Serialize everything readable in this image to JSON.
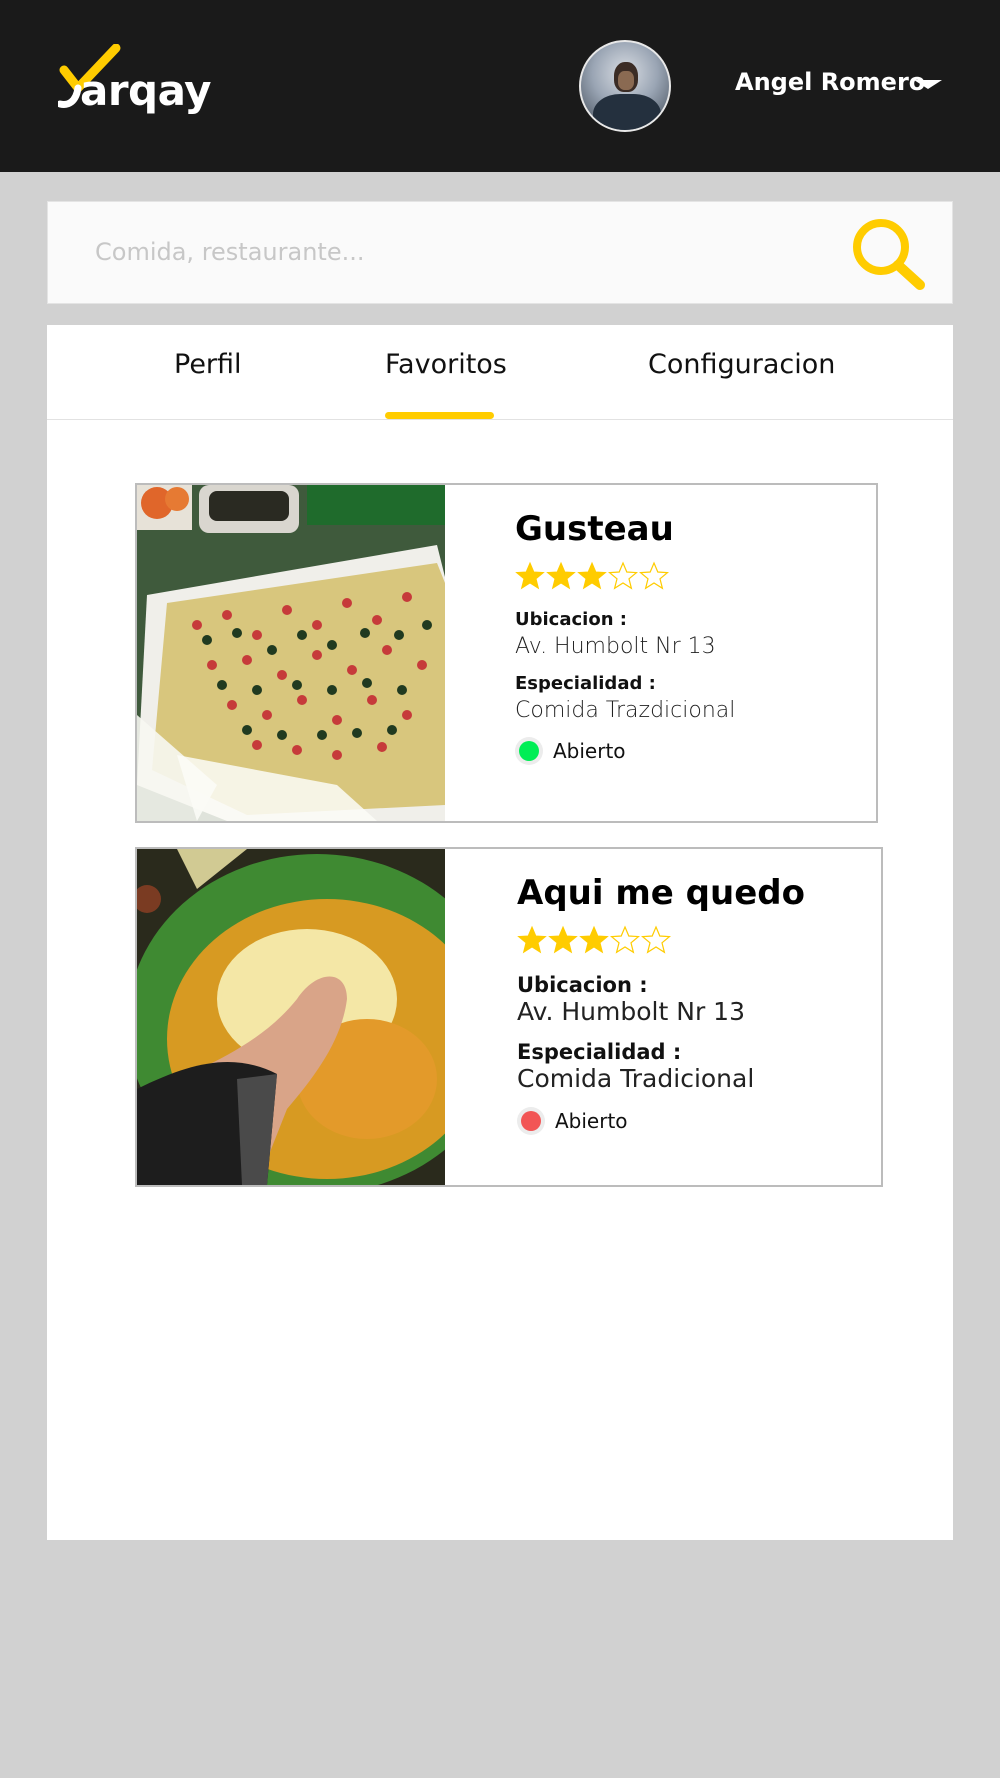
{
  "header": {
    "logo_text": "arqay",
    "user_name": "Angel Romero"
  },
  "colors": {
    "header_bg": "#1a1a1a",
    "accent": "#ffcc00",
    "page_bg": "#d1d1d1",
    "status_open_green": "#00ee55",
    "status_red": "#f25555"
  },
  "search": {
    "placeholder": "Comida, restaurante...",
    "value": "",
    "icon": "search-icon"
  },
  "tabs": [
    {
      "label": "Perfil",
      "active": false
    },
    {
      "label": "Favoritos",
      "active": true
    },
    {
      "label": "Configuracion",
      "active": false
    }
  ],
  "favorites": [
    {
      "name": "Gusteau",
      "rating": 3,
      "rating_max": 5,
      "location_label": "Ubicacion :",
      "location": "Av. Humbolt Nr 13",
      "specialty_label": "Especialidad :",
      "specialty": "Comida Trazdicional",
      "status": "Abierto",
      "status_color": "#00ee55"
    },
    {
      "name": "Aqui me quedo",
      "rating": 3,
      "rating_max": 5,
      "location_label": "Ubicacion :",
      "location": "Av. Humbolt Nr 13",
      "specialty_label": "Especialidad :",
      "specialty": "Comida Tradicional",
      "status": "Abierto",
      "status_color": "#f25555"
    }
  ]
}
